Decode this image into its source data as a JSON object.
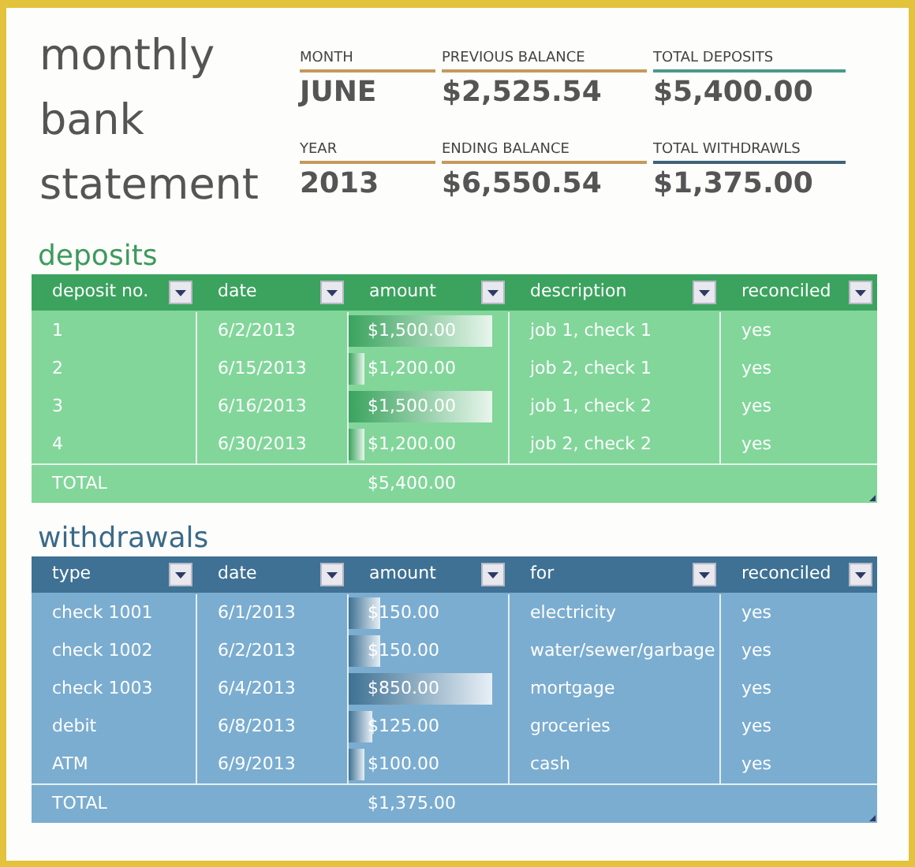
{
  "title_lines": [
    "monthly",
    "bank",
    "statement"
  ],
  "summary": [
    {
      "label": "MONTH",
      "value": "JUNE",
      "color": "#c49a5c"
    },
    {
      "label": "PREVIOUS BALANCE",
      "value": "$2,525.54",
      "color": "#c49a5c"
    },
    {
      "label": "TOTAL DEPOSITS",
      "value": "$5,400.00",
      "color": "#4a9a8a"
    },
    {
      "label": "YEAR",
      "value": "2013",
      "color": "#c49a5c"
    },
    {
      "label": "ENDING BALANCE",
      "value": "$6,550.54",
      "color": "#c49a5c"
    },
    {
      "label": "TOTAL WITHDRAWLS",
      "value": "$1,375.00",
      "color": "#3f6378"
    }
  ],
  "tables": [
    {
      "kind": "deposits",
      "title": "deposits",
      "columns": [
        "deposit no.",
        "date",
        "amount",
        "description",
        "reconciled"
      ],
      "rows": [
        {
          "cells": [
            "1",
            "6/2/2013",
            "$1,500.00",
            "job 1, check 1",
            "yes"
          ],
          "level": 0.9
        },
        {
          "cells": [
            "2",
            "6/15/2013",
            "$1,200.00",
            "job 2, check 1",
            "yes"
          ],
          "level": 0.1
        },
        {
          "cells": [
            "3",
            "6/16/2013",
            "$1,500.00",
            "job 1, check 2",
            "yes"
          ],
          "level": 0.9
        },
        {
          "cells": [
            "4",
            "6/30/2013",
            "$1,200.00",
            "job 2, check 2",
            "yes"
          ],
          "level": 0.1
        }
      ],
      "total": {
        "label": "TOTAL",
        "amount": "$5,400.00"
      }
    },
    {
      "kind": "withdrawals",
      "title": "withdrawals",
      "columns": [
        "type",
        "date",
        "amount",
        "for",
        "reconciled"
      ],
      "rows": [
        {
          "cells": [
            "check 1001",
            "6/1/2013",
            "$150.00",
            "electricity",
            "yes"
          ],
          "level": 0.2
        },
        {
          "cells": [
            "check 1002",
            "6/2/2013",
            "$150.00",
            "water/sewer/garbage",
            "yes"
          ],
          "level": 0.2
        },
        {
          "cells": [
            "check 1003",
            "6/4/2013",
            "$850.00",
            "mortgage",
            "yes"
          ],
          "level": 0.9
        },
        {
          "cells": [
            "debit",
            "6/8/2013",
            "$125.00",
            "groceries",
            "yes"
          ],
          "level": 0.15
        },
        {
          "cells": [
            "ATM",
            "6/9/2013",
            "$100.00",
            "cash",
            "yes"
          ],
          "level": 0.1
        }
      ],
      "total": {
        "label": "TOTAL",
        "amount": "$1,375.00"
      }
    }
  ]
}
